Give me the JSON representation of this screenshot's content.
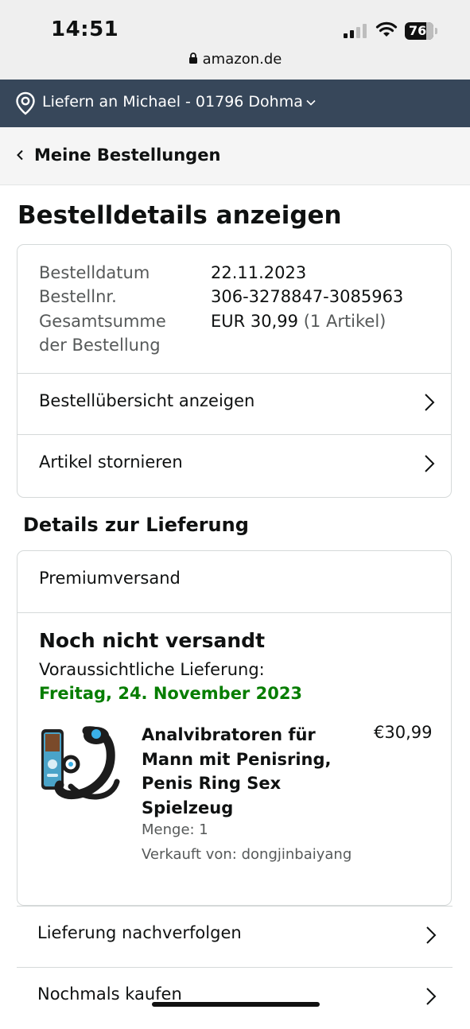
{
  "status_bar": {
    "time": "14:51",
    "battery": "76",
    "url": "amazon.de"
  },
  "location_bar": {
    "text": "Liefern an Michael - 01796 Dohma"
  },
  "back_nav": {
    "label": "Meine Bestellungen"
  },
  "page_title": "Bestelldetails anzeigen",
  "order_summary": {
    "date_label": "Bestelldatum",
    "date_value": "22.11.2023",
    "number_label": "Bestellnr.",
    "number_value": "306-3278847-3085963",
    "total_label_line1": "Gesamtsumme",
    "total_label_line2": "der Bestellung",
    "total_value": "EUR 30,99",
    "total_items": "(1 Artikel)",
    "actions": [
      {
        "label": "Bestellübersicht anzeigen"
      },
      {
        "label": "Artikel stornieren"
      }
    ]
  },
  "delivery": {
    "section_title": "Details zur Lieferung",
    "shipping_speed": "Premiumversand",
    "status": "Noch nicht versandt",
    "expected_label": "Voraussichtliche Lieferung:",
    "expected_date": "Freitag, 24. November 2023",
    "product": {
      "title": "Analvibratoren für Mann mit Penisring, Penis Ring Sex Spielzeug",
      "price": "€30,99",
      "quantity": "Menge: 1",
      "seller": "Verkauft von: dongjinbaiyang"
    }
  },
  "bottom_actions": [
    {
      "label": "Lieferung nachverfolgen"
    },
    {
      "label": "Nochmals kaufen"
    }
  ]
}
